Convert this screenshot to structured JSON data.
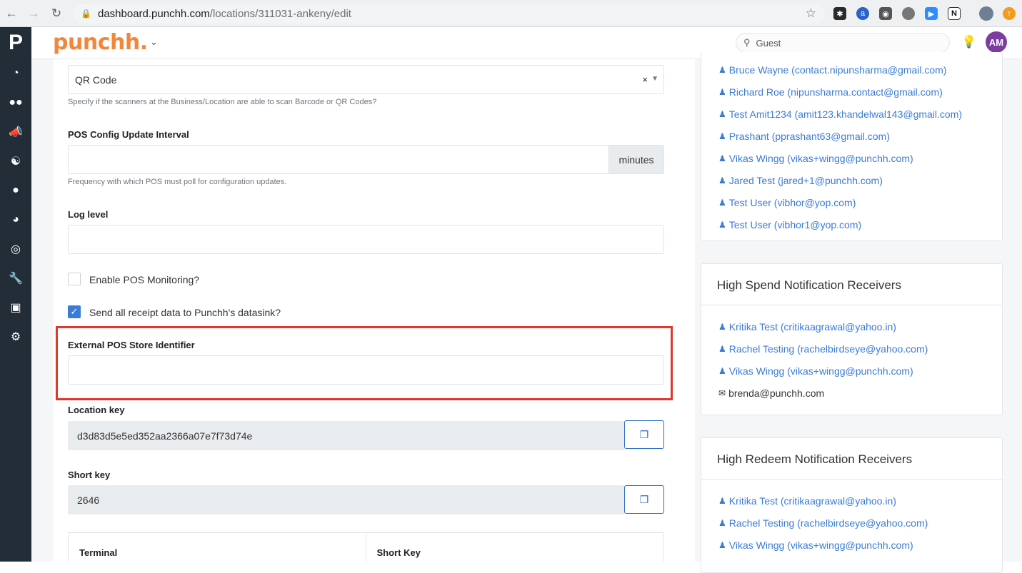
{
  "browser": {
    "url_domain": "dashboard.punchh.com",
    "url_path": "/locations/311031-ankeny/edit"
  },
  "app": {
    "brand": "punchh.",
    "search_placeholder": "Guest",
    "avatar_initials": "AM"
  },
  "form": {
    "scan_type_value": "QR Code",
    "scan_type_help": "Specify if the scanners at the Business/Location are able to scan Barcode or QR Codes?",
    "pos_interval_label": "POS Config Update Interval",
    "pos_interval_value": "",
    "pos_interval_addon": "minutes",
    "pos_interval_help": "Frequency with which POS must poll for configuration updates.",
    "log_level_label": "Log level",
    "log_level_value": "",
    "pos_monitoring_label": "Enable POS Monitoring?",
    "datasink_label": "Send all receipt data to Punchh's datasink?",
    "external_id_label": "External POS Store Identifier",
    "external_id_value": "",
    "location_key_label": "Location key",
    "location_key_value": "d3d83d5e5ed352aa2366a07e7f73d74e",
    "short_key_label": "Short key",
    "short_key_value": "2646",
    "table_headers": [
      "Terminal",
      "Short Key"
    ]
  },
  "receivers_top": [
    "Bruce Wayne (contact.nipunsharma@gmail.com)",
    "Richard Roe (nipunsharma.contact@gmail.com)",
    "Test Amit1234 (amit123.khandelwal143@gmail.com)",
    "Prashant (pprashant63@gmail.com)",
    "Vikas Wingg (vikas+wingg@punchh.com)",
    "Jared Test (jared+1@punchh.com)",
    "Test User (vibhor@yop.com)",
    "Test User (vibhor1@yop.com)"
  ],
  "high_spend": {
    "title": "High Spend Notification Receivers",
    "users": [
      "Kritika Test (critikaagrawal@yahoo.in)",
      "Rachel Testing (rachelbirdseye@yahoo.com)",
      "Vikas Wingg (vikas+wingg@punchh.com)"
    ],
    "email": "brenda@punchh.com"
  },
  "high_redeem": {
    "title": "High Redeem Notification Receivers",
    "users": [
      "Kritika Test (critikaagrawal@yahoo.in)",
      "Rachel Testing (rachelbirdseye@yahoo.com)",
      "Vikas Wingg (vikas+wingg@punchh.com)"
    ]
  },
  "colors": {
    "accent": "#3a7bd5",
    "brand": "#f4863b",
    "highlight": "#e0392b",
    "sidebar": "#222d38"
  }
}
